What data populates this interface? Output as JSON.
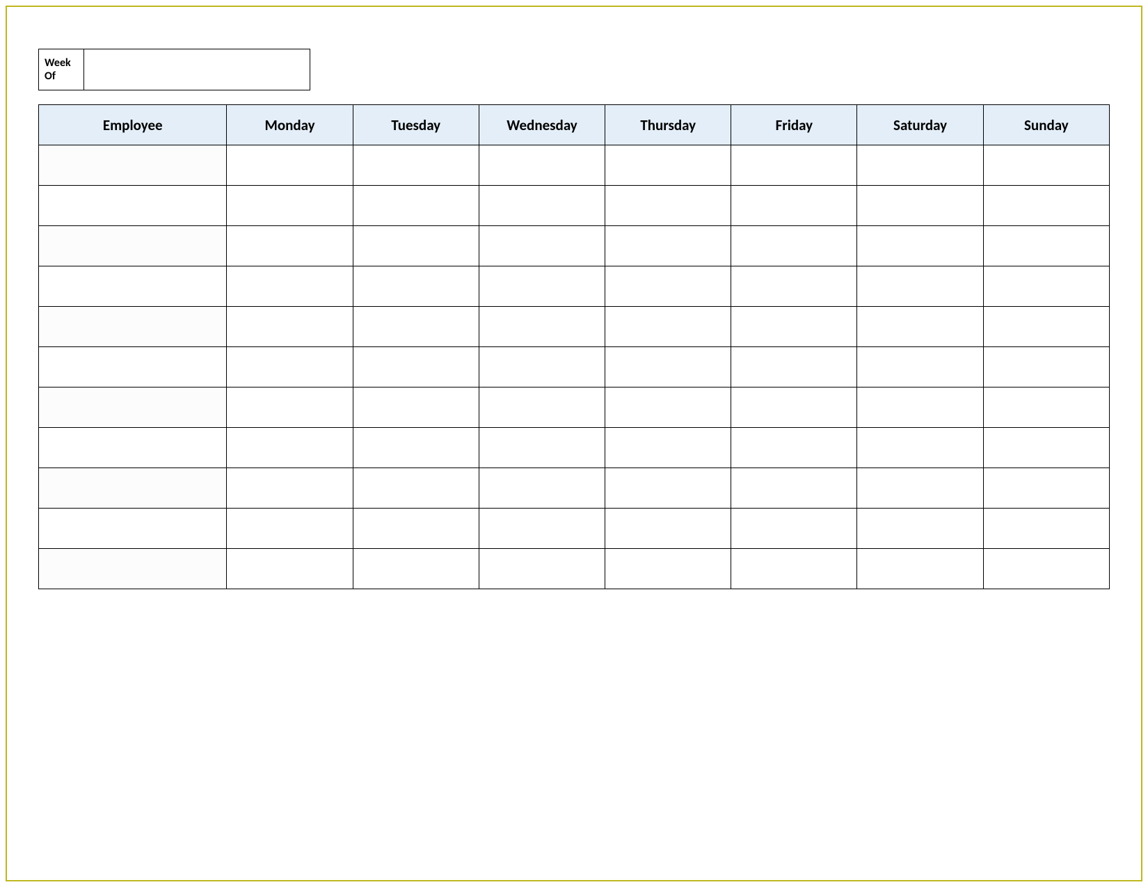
{
  "weekOf": {
    "label": "Week Of",
    "value": ""
  },
  "table": {
    "headers": {
      "employee": "Employee",
      "days": [
        "Monday",
        "Tuesday",
        "Wednesday",
        "Thursday",
        "Friday",
        "Saturday",
        "Sunday"
      ]
    },
    "rows": [
      {
        "employee": "",
        "days": [
          "",
          "",
          "",
          "",
          "",
          "",
          ""
        ]
      },
      {
        "employee": "",
        "days": [
          "",
          "",
          "",
          "",
          "",
          "",
          ""
        ]
      },
      {
        "employee": "",
        "days": [
          "",
          "",
          "",
          "",
          "",
          "",
          ""
        ]
      },
      {
        "employee": "",
        "days": [
          "",
          "",
          "",
          "",
          "",
          "",
          ""
        ]
      },
      {
        "employee": "",
        "days": [
          "",
          "",
          "",
          "",
          "",
          "",
          ""
        ]
      },
      {
        "employee": "",
        "days": [
          "",
          "",
          "",
          "",
          "",
          "",
          ""
        ]
      },
      {
        "employee": "",
        "days": [
          "",
          "",
          "",
          "",
          "",
          "",
          ""
        ]
      },
      {
        "employee": "",
        "days": [
          "",
          "",
          "",
          "",
          "",
          "",
          ""
        ]
      },
      {
        "employee": "",
        "days": [
          "",
          "",
          "",
          "",
          "",
          "",
          ""
        ]
      },
      {
        "employee": "",
        "days": [
          "",
          "",
          "",
          "",
          "",
          "",
          ""
        ]
      },
      {
        "employee": "",
        "days": [
          "",
          "",
          "",
          "",
          "",
          "",
          ""
        ]
      }
    ]
  }
}
